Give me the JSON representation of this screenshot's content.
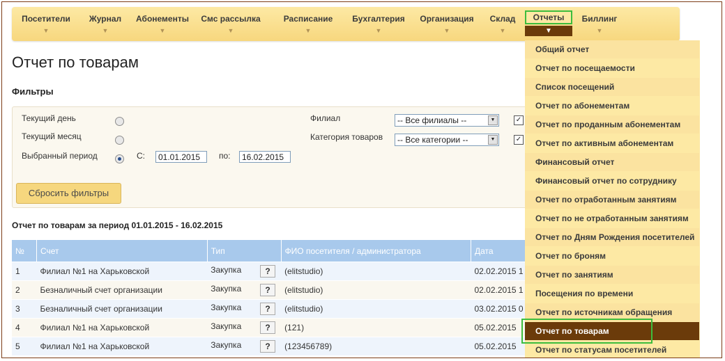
{
  "nav": {
    "items": [
      {
        "label": "Посетители"
      },
      {
        "label": "Журнал"
      },
      {
        "label": "Абонементы"
      },
      {
        "label": "Смс рассылка"
      },
      {
        "label": "Расписание"
      },
      {
        "label": "Бухгалтерия"
      },
      {
        "label": "Организация"
      },
      {
        "label": "Склад"
      },
      {
        "label": "Отчеты"
      },
      {
        "label": "Биллинг"
      }
    ],
    "arrow": "▼"
  },
  "page_title": "Отчет по товарам",
  "filters": {
    "title": "Фильтры",
    "current_day": "Текущий день",
    "current_month": "Текущий месяц",
    "selected_period": "Выбранный период",
    "from_label": "С:",
    "from_value": "01.01.2015",
    "to_label": "по:",
    "to_value": "16.02.2015",
    "branch_label": "Филиал",
    "branch_value": "-- Все филиалы --",
    "category_label": "Категория товаров",
    "category_value": "-- Все категории --",
    "reset_button": "Сбросить фильтры"
  },
  "report_title": "Отчет по товарам за период 01.01.2015 - 16.02.2015",
  "table": {
    "headers": [
      "№",
      "Счет",
      "Тип",
      "ФИО посетителя / администратора",
      "Дата"
    ],
    "rows": [
      {
        "n": "1",
        "account": "Филиал №1 на Харьковской",
        "type": "Закупка",
        "name": "(elitstudio)",
        "date": "02.02.2015 1"
      },
      {
        "n": "2",
        "account": "Безналичный счет организации",
        "type": "Закупка",
        "name": "(elitstudio)",
        "date": "02.02.2015 1"
      },
      {
        "n": "3",
        "account": "Безналичный счет организации",
        "type": "Закупка",
        "name": "(elitstudio)",
        "date": "03.02.2015 0"
      },
      {
        "n": "4",
        "account": "Филиал №1 на Харьковской",
        "type": "Закупка",
        "name": "(121)",
        "date": "05.02.2015"
      },
      {
        "n": "5",
        "account": "Филиал №1 на Харьковской",
        "type": "Закупка",
        "name": "(123456789)",
        "date": "05.02.2015"
      }
    ],
    "help": "?"
  },
  "dropdown": {
    "items": [
      "Общий отчет",
      "Отчет по посещаемости",
      "Список посещений",
      "Отчет по абонементам",
      "Отчет по проданным абонементам",
      "Отчет по активным абонементам",
      "Финансовый отчет",
      "Финансовый отчет по сотруднику",
      "Отчет по отработанным занятиям",
      "Отчет по не отработанным занятиям",
      "Отчет по Дням Рождения посетителей",
      "Отчет по броням",
      "Отчет по занятиям",
      "Посещения по времени",
      "Отчет по источникам обращения",
      "Отчет по товарам",
      "Отчет по статусам посетителей"
    ]
  },
  "colors": {
    "accent_brown": "#6b3b0a",
    "highlight_green": "#3dbd3d",
    "table_header": "#a8c9ec"
  }
}
